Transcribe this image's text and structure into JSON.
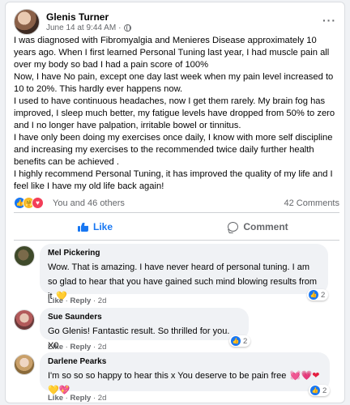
{
  "post": {
    "author": "Glenis Turner",
    "timestamp": "June 14 at 9:44 AM",
    "visibility_icon": "globe-icon",
    "more_icon": "···",
    "paragraphs": [
      "I was diagnosed with Fibromyalgia and Menieres Disease approximately 10 years ago. When I first learned Personal Tuning last year, I had muscle pain all over my body so bad I had a pain score of 100%",
      "Now, I have No pain, except one day last week when my pain level  increased to 10 to 20%. This hardly ever happens now.",
      "I used to have continuous headaches,  now I get them rarely.  My brain fog has improved, I sleep much better, my fatigue levels have dropped from 50% to zero and I no longer have palpation, irritable bowel or tinnitus.",
      "I have only been doing my exercises once daily,  I know with more self discipline and increasing my exercises to the recommended twice daily further health benefits can be achieved .",
      "I highly recommend Personal Tuning,  it has improved the quality of my life and I feel like I have my old life back again!"
    ]
  },
  "reactions": {
    "icons": [
      "like-icon",
      "care-icon",
      "love-icon"
    ],
    "summary": "You and 46 others",
    "comments_count": "42 Comments"
  },
  "actions": {
    "like_label": "Like",
    "comment_label": "Comment"
  },
  "comments": [
    {
      "name": "Mel Pickering",
      "text": "Wow. That is amazing. I have never heard of personal tuning. I am so glad to hear that you have gained such mind blowing results from it",
      "emoji": "💛",
      "like_label": "Like",
      "reply_label": "Reply",
      "age": "2d",
      "reaction_count": "2"
    },
    {
      "name": "Sue Saunders",
      "text": "Go Glenis! Fantastic result. So thrilled for you. X0",
      "like_label": "Like",
      "reply_label": "Reply",
      "age": "2d",
      "reaction_count": "2"
    },
    {
      "name": "Darlene Pearks",
      "text": "I'm so so so happy to hear this x You deserve to be pain free",
      "emoji_inline": "💓💗❤",
      "emoji_line2": "💛💖",
      "like_label": "Like",
      "reply_label": "Reply",
      "age": "2d",
      "reaction_count": "2"
    }
  ],
  "colors": {
    "accent": "#1877f2",
    "secondary_text": "#65676b",
    "bubble": "#f0f2f5"
  }
}
